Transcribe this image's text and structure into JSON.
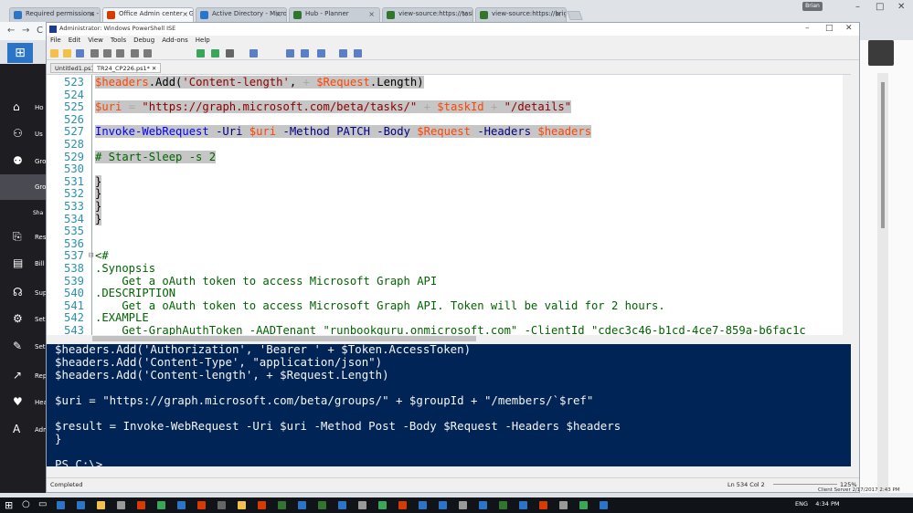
{
  "browser": {
    "tabs": [
      {
        "label": "Required permissions - I",
        "color": "#2b74c7"
      },
      {
        "label": "Office Admin center - G",
        "color": "#d83b01"
      },
      {
        "label": "Active Directory - Micro",
        "color": "#2b74c7"
      },
      {
        "label": "Hub - Planner",
        "color": "#31752f"
      },
      {
        "label": "view-source:https://task",
        "color": "#31752f"
      },
      {
        "label": "view-source:https://brig",
        "color": "#31752f"
      }
    ],
    "user_badge": "Brian",
    "window_controls": [
      "–",
      "□",
      "✕"
    ]
  },
  "app_rail": {
    "items": [
      {
        "icon": "home-icon",
        "glyph": "⌂",
        "label": "Ho"
      },
      {
        "icon": "user-icon",
        "glyph": "⚇",
        "label": "Us"
      },
      {
        "icon": "groups-icon",
        "glyph": "⚉",
        "label": "Gro"
      },
      {
        "icon": "groups-icon",
        "glyph": "",
        "label": "Gro"
      },
      {
        "icon": "resources-icon",
        "glyph": "⎘",
        "label": "Res"
      },
      {
        "icon": "billing-icon",
        "glyph": "▤",
        "label": "Bill"
      },
      {
        "icon": "support-icon",
        "glyph": "☊",
        "label": "Sup"
      },
      {
        "icon": "settings-icon",
        "glyph": "⚙",
        "label": "Set"
      },
      {
        "icon": "setup-icon",
        "glyph": "✎",
        "label": "Set"
      },
      {
        "icon": "reports-icon",
        "glyph": "↗",
        "label": "Rep"
      },
      {
        "icon": "health-icon",
        "glyph": "♥",
        "label": "Hea"
      },
      {
        "icon": "admin-icon",
        "glyph": "A",
        "label": "Adm"
      }
    ],
    "sub_label": "Sha"
  },
  "ise": {
    "title": "Administrator: Windows PowerShell ISE",
    "menu": [
      "File",
      "Edit",
      "View",
      "Tools",
      "Debug",
      "Add-ons",
      "Help"
    ],
    "tabs": [
      "Untitled1.ps1",
      "TR24_CP226.ps1*"
    ],
    "tab_close": "✕",
    "status": {
      "left": "Completed",
      "position": "Ln 534  Col 2",
      "zoom": "125%"
    }
  },
  "editor": {
    "lines": [
      {
        "n": "523",
        "sel": true,
        "tokens": [
          [
            "var",
            "$headers"
          ],
          [
            "txt",
            "."
          ],
          [
            "txt",
            "Add("
          ],
          [
            "str",
            "'Content-length'"
          ],
          [
            "txt",
            ", "
          ],
          [
            "op",
            "+"
          ],
          [
            "txt",
            " "
          ],
          [
            "var",
            "$Request"
          ],
          [
            "txt",
            "."
          ],
          [
            "txt",
            "Length)"
          ]
        ]
      },
      {
        "n": "524",
        "sel": false,
        "tokens": []
      },
      {
        "n": "525",
        "sel": true,
        "tokens": [
          [
            "var",
            "$uri"
          ],
          [
            "txt",
            " "
          ],
          [
            "op",
            "="
          ],
          [
            "txt",
            " "
          ],
          [
            "str",
            "\"https://graph.microsoft.com/beta/tasks/\""
          ],
          [
            "txt",
            " "
          ],
          [
            "op",
            "+"
          ],
          [
            "txt",
            " "
          ],
          [
            "var",
            "$taskId"
          ],
          [
            "txt",
            " "
          ],
          [
            "op",
            "+"
          ],
          [
            "txt",
            " "
          ],
          [
            "str",
            "\"/details\""
          ]
        ]
      },
      {
        "n": "526",
        "sel": false,
        "tokens": []
      },
      {
        "n": "527",
        "sel": true,
        "tokens": [
          [
            "cmd",
            "Invoke-WebRequest"
          ],
          [
            "txt",
            " "
          ],
          [
            "prm",
            "-Uri"
          ],
          [
            "txt",
            " "
          ],
          [
            "var",
            "$uri"
          ],
          [
            "txt",
            " "
          ],
          [
            "prm",
            "-Method"
          ],
          [
            "txt",
            " "
          ],
          [
            "kw",
            "PATCH"
          ],
          [
            "txt",
            " "
          ],
          [
            "prm",
            "-Body"
          ],
          [
            "txt",
            " "
          ],
          [
            "var",
            "$Request"
          ],
          [
            "txt",
            " "
          ],
          [
            "prm",
            "-Headers"
          ],
          [
            "txt",
            " "
          ],
          [
            "var",
            "$headers"
          ]
        ]
      },
      {
        "n": "528",
        "sel": false,
        "tokens": []
      },
      {
        "n": "529",
        "sel": true,
        "tokens": [
          [
            "com",
            "# Start-Sleep -s 2"
          ]
        ]
      },
      {
        "n": "530",
        "sel": false,
        "tokens": []
      },
      {
        "n": "531",
        "sel": true,
        "tokens": [
          [
            "txt",
            "}"
          ]
        ]
      },
      {
        "n": "532",
        "sel": true,
        "tokens": [
          [
            "txt",
            "}"
          ]
        ]
      },
      {
        "n": "533",
        "sel": true,
        "tokens": [
          [
            "txt",
            "}"
          ]
        ]
      },
      {
        "n": "534",
        "sel": true,
        "tokens": [
          [
            "txt",
            "}"
          ]
        ]
      },
      {
        "n": "535",
        "sel": false,
        "tokens": []
      },
      {
        "n": "536",
        "sel": false,
        "tokens": []
      },
      {
        "n": "537",
        "sel": false,
        "fold": "⊟",
        "tokens": [
          [
            "com",
            "<#"
          ]
        ]
      },
      {
        "n": "538",
        "sel": false,
        "tokens": [
          [
            "com",
            ".Synopsis"
          ]
        ]
      },
      {
        "n": "539",
        "sel": false,
        "tokens": [
          [
            "com",
            "    Get a oAuth token to access Microsoft Graph API"
          ]
        ]
      },
      {
        "n": "540",
        "sel": false,
        "tokens": [
          [
            "com",
            ".DESCRIPTION"
          ]
        ]
      },
      {
        "n": "541",
        "sel": false,
        "tokens": [
          [
            "com",
            "    Get a oAuth token to access Microsoft Graph API. Token will be valid for 2 hours."
          ]
        ]
      },
      {
        "n": "542",
        "sel": false,
        "tokens": [
          [
            "com",
            ".EXAMPLE"
          ]
        ]
      },
      {
        "n": "543",
        "sel": false,
        "tokens": [
          [
            "com",
            "    Get-GraphAuthToken -AADTenant \"runbookguru.onmicrosoft.com\" -ClientId \"cdec3c46-b1cd-4ce7-859a-b6fac1c"
          ]
        ]
      }
    ]
  },
  "console": {
    "lines": [
      "$headers.Add('Authorization', 'Bearer ' + $Token.AccessToken)",
      "$headers.Add('Content-Type', \"application/json\")",
      "$headers.Add('Content-length', + $Request.Length)",
      "",
      "$uri = \"https://graph.microsoft.com/beta/groups/\" + $groupId + \"/members/`$ref\"",
      "",
      "$result = Invoke-WebRequest -Uri $uri -Method Post -Body $Request -Headers $headers",
      "}",
      "",
      "PS C:\\>"
    ]
  },
  "taskbar": {
    "tray_time": "4:34 PM",
    "tray_lang": "ENG",
    "windows_badge": "Client Server 2/17/2017 2:43 PM"
  }
}
